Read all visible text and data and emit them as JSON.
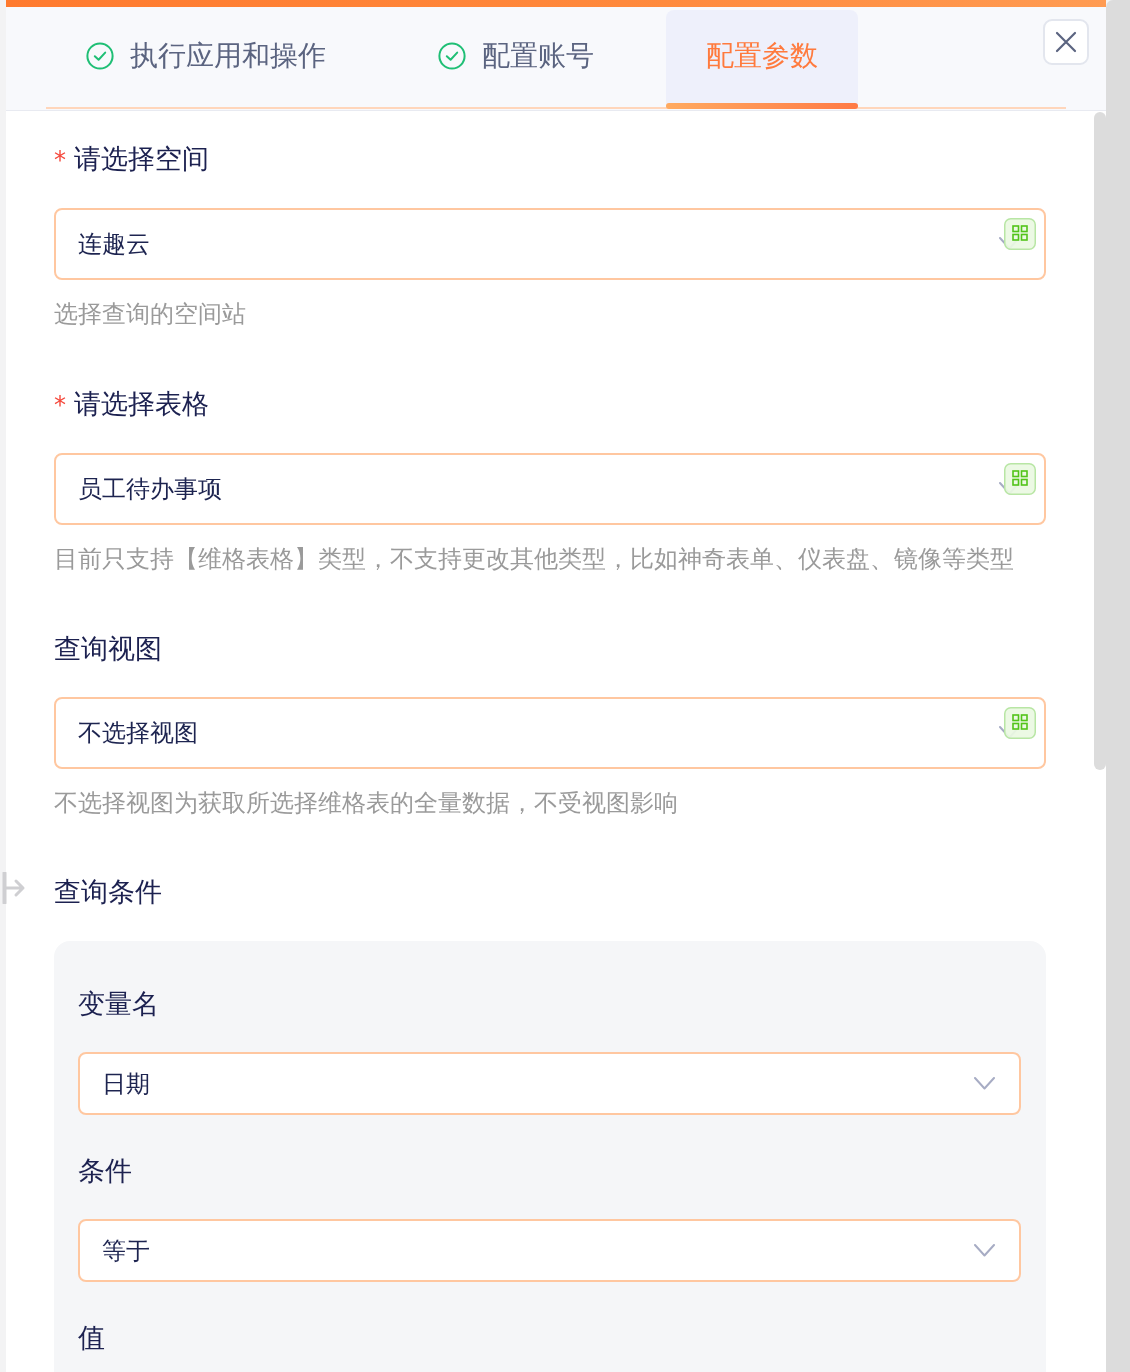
{
  "tabs": [
    {
      "label": "执行应用和操作",
      "completed": true,
      "selected": false
    },
    {
      "label": "配置账号",
      "completed": true,
      "selected": false
    },
    {
      "label": "配置参数",
      "completed": false,
      "selected": true
    }
  ],
  "fields": [
    {
      "required_mark": "*",
      "label": "请选择空间",
      "kind": "picker",
      "value": "连趣云",
      "help": "选择查询的空间站"
    },
    {
      "required_mark": "*",
      "label": "请选择表格",
      "kind": "picker",
      "value": "员工待办事项",
      "help": "目前只支持【维格表格】类型，不支持更改其他类型，比如神奇表单、仪表盘、镜像等类型"
    },
    {
      "label": "查询视图",
      "kind": "picker",
      "value": "不选择视图",
      "help": "不选择视图为获取所选择维格表的全量数据，不受视图影响"
    }
  ],
  "conditions": {
    "title": "查询条件",
    "rows": [
      {
        "label": "变量名",
        "kind": "select",
        "value": "日期"
      },
      {
        "label": "条件",
        "kind": "select",
        "value": "等于"
      },
      {
        "label": "值"
      }
    ]
  }
}
